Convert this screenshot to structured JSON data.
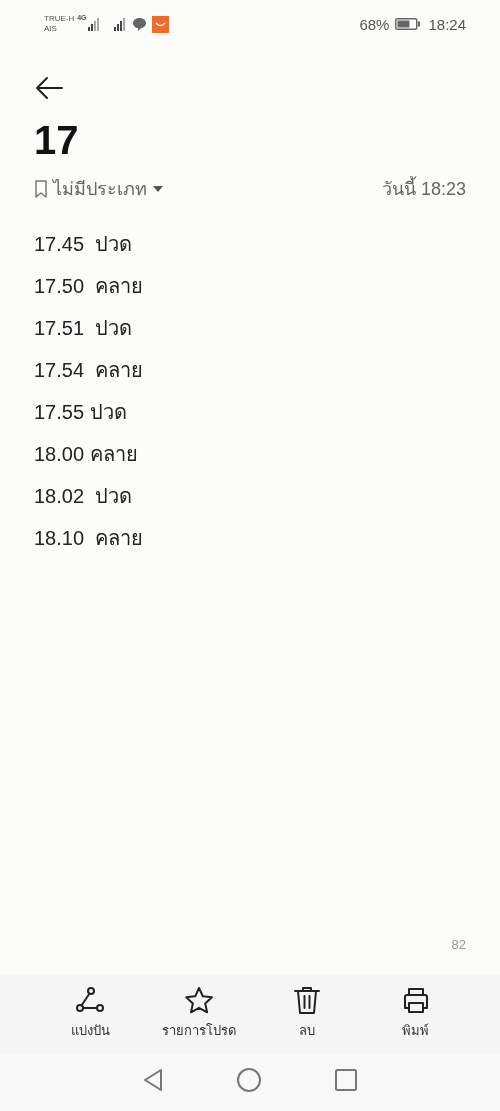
{
  "status_bar": {
    "carriers": [
      "TRUE-H",
      "AIS"
    ],
    "network": "4G",
    "battery": "68%",
    "time": "18:24"
  },
  "note": {
    "title": "17",
    "category": "ไม่มีประเภท",
    "date": "วันนี้ 18:23",
    "lines": [
      "17.45  ปวด",
      "17.50  คลาย",
      "17.51  ปวด",
      "17.54  คลาย",
      "17.55 ปวด",
      "18.00 คลาย",
      "18.02  ปวด",
      "18.10  คลาย"
    ],
    "char_count": "82"
  },
  "toolbar": [
    {
      "kind": "share",
      "label": "แบ่งปัน"
    },
    {
      "kind": "favorite",
      "label": "รายการโปรด"
    },
    {
      "kind": "delete",
      "label": "ลบ"
    },
    {
      "kind": "print",
      "label": "พิมพ์"
    }
  ]
}
